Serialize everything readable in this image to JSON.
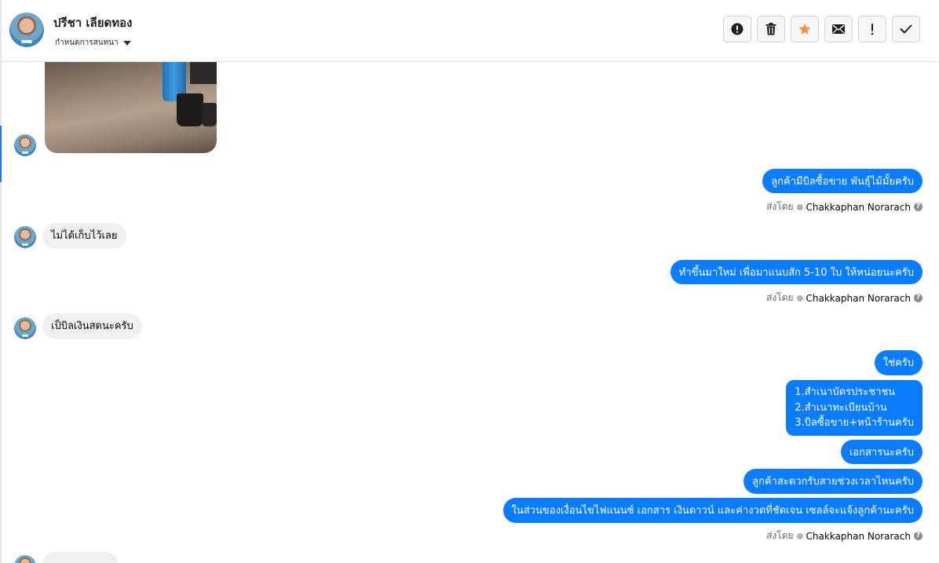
{
  "header": {
    "contact_name": "ปรีชา เลียดทอง",
    "assign_label": "กำหนดการสนทนา",
    "toolbar_icons": [
      "alert-circle-icon",
      "trash-icon",
      "star-icon",
      "envelope-icon",
      "exclamation-icon",
      "check-icon"
    ],
    "star_color": "#f7923b"
  },
  "messages": {
    "out_1": "ลูกค้ามีบิลซื้อขาย พันธุ์ไม้มั้ยครับ",
    "in_1": "ไม่ได้เก็บไว้เลย",
    "out_2": "ทำขึ้นมาใหม่ เพื่อมาแนบสัก 5-10 ใบ ให้หน่อยนะครับ",
    "in_2": "เป็บิลเงินสดนะครับ",
    "out_3": "ใช่ครับ",
    "out_4": "1.สำเนาบัตรประชาชน\n2.สำเนาทะเบียนบ้าน\n3.บิลซื้อขาย+หน้าร้านครับ",
    "out_5": "เอกสารนะครับ",
    "out_6": "ลูกค้าสะดวกรับสายช่วงเวลาไหนครับ",
    "out_7": "ในส่วนของเงื่อนไขไฟแนนซ์ เอกสาร เงินดาวน์ และค่างวดที่ชัดเจน เซลล์จะแจ้งลูกค้านะครับ"
  },
  "sent_by": {
    "prefix": "ส่งโดย",
    "name": "Chakkaphan Norarach",
    "help": "?"
  },
  "colors": {
    "outgoing_bubble": "#0a7cff",
    "incoming_bubble": "#f0f0f0"
  }
}
